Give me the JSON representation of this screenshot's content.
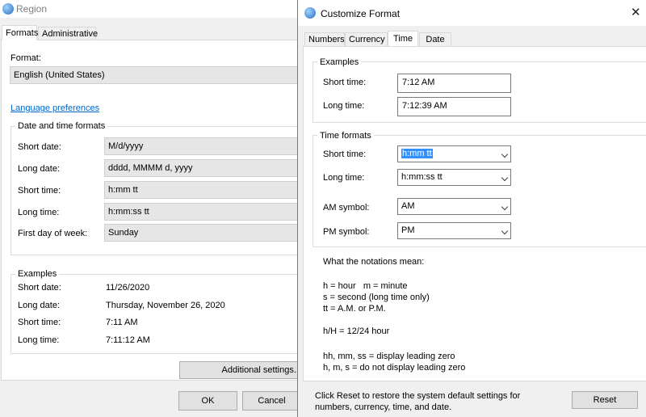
{
  "region": {
    "title": "Region",
    "tabs": [
      "Formats",
      "Administrative"
    ],
    "format_label": "Format:",
    "format_value": "English (United States)",
    "language_link": "Language preferences",
    "dt_group_label": "Date and time formats",
    "fields": [
      {
        "label": "Short date:",
        "value": "M/d/yyyy"
      },
      {
        "label": "Long date:",
        "value": "dddd, MMMM d, yyyy"
      },
      {
        "label": "Short time:",
        "value": "h:mm tt"
      },
      {
        "label": "Long time:",
        "value": "h:mm:ss tt"
      },
      {
        "label": "First day of week:",
        "value": "Sunday"
      }
    ],
    "examples_label": "Examples",
    "examples": [
      {
        "label": "Short date:",
        "value": "11/26/2020"
      },
      {
        "label": "Long date:",
        "value": "Thursday, November 26, 2020"
      },
      {
        "label": "Short time:",
        "value": "7:11 AM"
      },
      {
        "label": "Long time:",
        "value": "7:11:12 AM"
      }
    ],
    "additional_settings": "Additional settings...",
    "ok": "OK",
    "cancel": "Cancel"
  },
  "customize": {
    "title": "Customize Format",
    "close": "✕",
    "tabs": [
      "Numbers",
      "Currency",
      "Time",
      "Date"
    ],
    "examples_label": "Examples",
    "examples": [
      {
        "label": "Short time:",
        "value": "7:12 AM"
      },
      {
        "label": "Long time:",
        "value": "7:12:39 AM"
      }
    ],
    "time_formats_label": "Time formats",
    "formats": [
      {
        "label": "Short time:",
        "value": "h:mm tt"
      },
      {
        "label": "Long time:",
        "value": "h:mm:ss tt"
      },
      {
        "label": "AM symbol:",
        "value": "AM"
      },
      {
        "label": "PM symbol:",
        "value": "PM"
      }
    ],
    "notations_title": "What the notations mean:",
    "notation_lines": [
      "h = hour   m = minute",
      "s = second (long time only)",
      "tt = A.M. or P.M.",
      "h/H = 12/24 hour",
      "hh, mm, ss = display leading zero",
      "h, m, s = do not display leading zero"
    ],
    "reset_note_1": "Click Reset to restore the system default settings for",
    "reset_note_2": "numbers, currency, time, and date.",
    "reset": "Reset"
  }
}
